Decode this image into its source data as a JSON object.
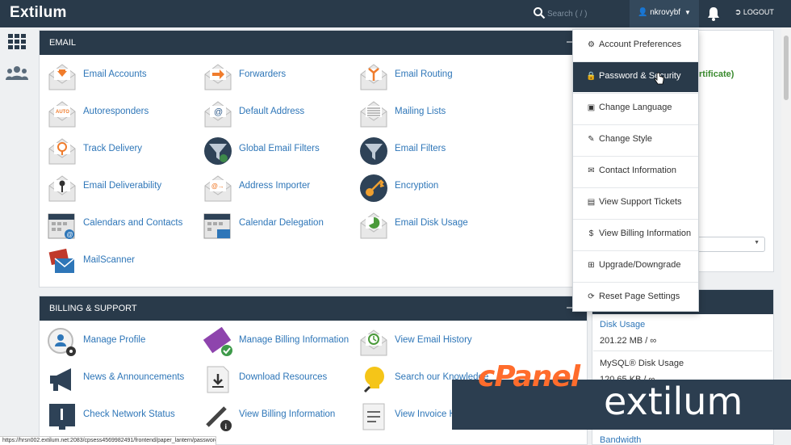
{
  "header": {
    "brand": "Extilum",
    "search_placeholder": "Search ( / )",
    "username": "nkrovybf",
    "logout_label": "LOGOUT"
  },
  "email_panel": {
    "title": "EMAIL",
    "items": [
      {
        "label": "Email Accounts",
        "icon": "email-accounts-icon"
      },
      {
        "label": "Forwarders",
        "icon": "forwarders-icon"
      },
      {
        "label": "Email Routing",
        "icon": "email-routing-icon"
      },
      {
        "label": "Autoresponders",
        "icon": "autoresponders-icon"
      },
      {
        "label": "Default Address",
        "icon": "default-address-icon"
      },
      {
        "label": "Mailing Lists",
        "icon": "mailing-lists-icon"
      },
      {
        "label": "Track Delivery",
        "icon": "track-delivery-icon"
      },
      {
        "label": "Global Email Filters",
        "icon": "global-filter-icon"
      },
      {
        "label": "Email Filters",
        "icon": "email-filter-icon"
      },
      {
        "label": "Email Deliverability",
        "icon": "deliverability-icon"
      },
      {
        "label": "Address Importer",
        "icon": "address-importer-icon"
      },
      {
        "label": "Encryption",
        "icon": "encryption-key-icon"
      },
      {
        "label": "Calendars and Contacts",
        "icon": "calendar-icon"
      },
      {
        "label": "Calendar Delegation",
        "icon": "calendar-delegation-icon"
      },
      {
        "label": "Email Disk Usage",
        "icon": "disk-usage-icon"
      },
      {
        "label": "MailScanner",
        "icon": "mailscanner-icon"
      }
    ]
  },
  "billing_panel": {
    "title": "BILLING & SUPPORT",
    "items": [
      {
        "label": "Manage Profile",
        "icon": "profile-icon"
      },
      {
        "label": "Manage Billing Information",
        "icon": "billing-card-icon"
      },
      {
        "label": "View Email History",
        "icon": "email-history-icon"
      },
      {
        "label": "News & Announcements",
        "icon": "megaphone-icon"
      },
      {
        "label": "Download Resources",
        "icon": "download-icon"
      },
      {
        "label": "Search our Knowledge",
        "icon": "lightbulb-icon"
      },
      {
        "label": "Check Network Status",
        "icon": "network-status-icon"
      },
      {
        "label": "View Billing Information",
        "icon": "billing-info-icon"
      },
      {
        "label": "View Invoice H",
        "icon": "invoice-icon"
      }
    ]
  },
  "dropdown": {
    "items": [
      {
        "label": "Account Preferences",
        "icon": "gears-icon"
      },
      {
        "label": "Password & Security",
        "icon": "lock-icon"
      },
      {
        "label": "Change Language",
        "icon": "language-icon"
      },
      {
        "label": "Change Style",
        "icon": "brush-icon"
      },
      {
        "label": "Contact Information",
        "icon": "envelope-icon"
      },
      {
        "label": "View Support Tickets",
        "icon": "ticket-icon"
      },
      {
        "label": "View Billing Information",
        "icon": "dollar-icon"
      },
      {
        "label": "Upgrade/Downgrade",
        "icon": "plus-square-icon"
      },
      {
        "label": "Reset Page Settings",
        "icon": "refresh-icon"
      }
    ]
  },
  "right_column": {
    "ssl_text": "rtificate)",
    "disk_usage_label": "Disk Usage",
    "disk_usage_value": "201.22 MB / ∞",
    "mysql_label": "MySQL® Disk Usage",
    "mysql_value": "120.65 KB / ∞",
    "bandwidth_label": "Bandwidth"
  },
  "overlay": {
    "cpanel": "cPanel",
    "extilum": "extilum"
  },
  "statusbar": {
    "url": "https://hrsn002.extilum.net:2083/cpsess4569982491/frontend/paper_lantern/password/index.html"
  },
  "colors": {
    "navbar": "#293a4a",
    "link": "#2e76b8",
    "cpanel_orange": "#ff6c2c"
  }
}
